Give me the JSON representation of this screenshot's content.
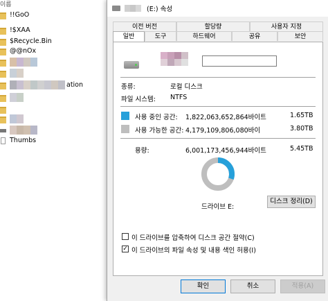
{
  "explorer": {
    "column_header": "이름",
    "items": [
      {
        "label": "!!GoO",
        "type": "folder"
      },
      {
        "label": "!$XAA",
        "type": "folder"
      },
      {
        "label": "$Recycle.Bin",
        "type": "folder"
      },
      {
        "label": "@@nOx",
        "type": "folder"
      },
      {
        "label": "",
        "type": "folder"
      },
      {
        "label": "",
        "type": "folder"
      },
      {
        "label": "ation",
        "type": "folder"
      },
      {
        "label": "",
        "type": "folder"
      },
      {
        "label": "",
        "type": "folder"
      },
      {
        "label": "",
        "type": "folder"
      },
      {
        "label": "",
        "type": "folder"
      },
      {
        "label": "Thumbs",
        "type": "file"
      }
    ]
  },
  "dialog": {
    "title": "(E:) 속성",
    "tabs_top": [
      "이전 버전",
      "할당량",
      "사용자 지정"
    ],
    "tabs_bottom": [
      "일반",
      "도구",
      "하드웨어",
      "공유",
      "보안"
    ],
    "active_tab": "일반",
    "name_value": "",
    "type_label": "종류:",
    "type_value": "로컬 디스크",
    "fs_label": "파일 시스템:",
    "fs_value": "NTFS",
    "used_label": "사용 중인 공간:",
    "used_bytes": "1,822,063,652,864바이트",
    "used_size": "1.65TB",
    "free_label": "사용 가능한 공간:",
    "free_bytes": "4,179,109,806,080바이",
    "free_size": "3.80TB",
    "capacity_label": "용량:",
    "capacity_bytes": "6,001,173,456,944바이트",
    "capacity_size": "5.45TB",
    "used_fraction": 0.3036,
    "drive_label": "드라이브 E:",
    "cleanup_button": "디스크 정리(D)",
    "compress_checkbox": "이 드라이브를 압축하여 디스크 공간 절약(C)",
    "compress_checked": false,
    "index_checkbox": "이 드라이브의 파일 속성 및 내용 색인 허용(I)",
    "index_checked": true,
    "ok_button": "확인",
    "cancel_button": "취소",
    "apply_button": "적용(A)"
  },
  "colors": {
    "used": "#26a0da",
    "free": "#bebebe",
    "folder": "#e8c15a"
  }
}
